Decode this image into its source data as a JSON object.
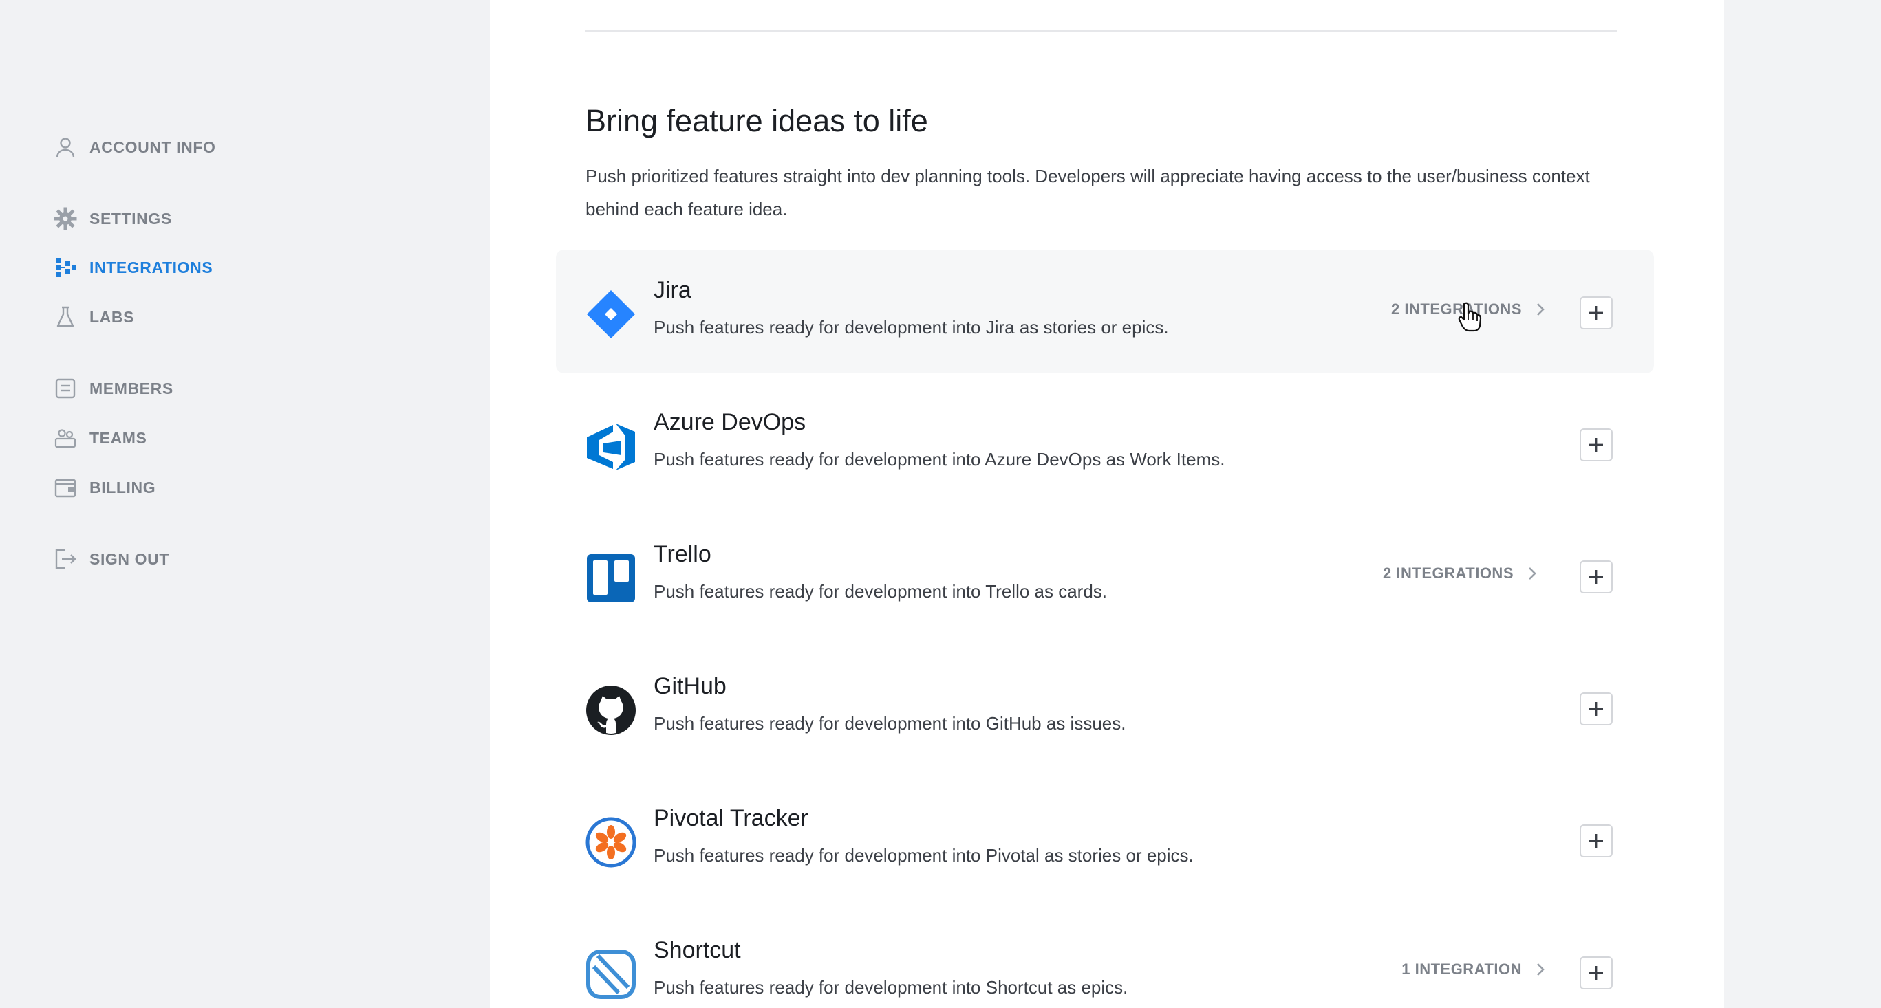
{
  "sidebar": {
    "items": [
      {
        "label": "ACCOUNT INFO",
        "icon": "user-icon",
        "active": false
      },
      {
        "label": "SETTINGS",
        "icon": "gear-icon",
        "active": false
      },
      {
        "label": "INTEGRATIONS",
        "icon": "integrations-icon",
        "active": true
      },
      {
        "label": "LABS",
        "icon": "flask-icon",
        "active": false
      },
      {
        "label": "MEMBERS",
        "icon": "members-icon",
        "active": false
      },
      {
        "label": "TEAMS",
        "icon": "teams-icon",
        "active": false
      },
      {
        "label": "BILLING",
        "icon": "wallet-icon",
        "active": false
      },
      {
        "label": "SIGN OUT",
        "icon": "sign-out-icon",
        "active": false
      }
    ]
  },
  "main": {
    "title": "Bring feature ideas to life",
    "description": "Push prioritized features straight into dev planning tools. Developers will appreciate having access to the user/business context behind each feature idea.",
    "integrations": [
      {
        "name": "Jira",
        "description": "Push features ready for development into Jira as stories or epics.",
        "count_label": "2 INTEGRATIONS",
        "icon": "jira-icon"
      },
      {
        "name": "Azure DevOps",
        "description": "Push features ready for development into Azure DevOps as Work Items.",
        "count_label": "",
        "icon": "azure-devops-icon"
      },
      {
        "name": "Trello",
        "description": "Push features ready for development into Trello as cards.",
        "count_label": "2 INTEGRATIONS",
        "icon": "trello-icon"
      },
      {
        "name": "GitHub",
        "description": "Push features ready for development into GitHub as issues.",
        "count_label": "",
        "icon": "github-icon"
      },
      {
        "name": "Pivotal Tracker",
        "description": "Push features ready for development into Pivotal as stories or epics.",
        "count_label": "",
        "icon": "pivotal-tracker-icon"
      },
      {
        "name": "Shortcut",
        "description": "Push features ready for development into Shortcut as epics.",
        "count_label": "1 INTEGRATION",
        "icon": "shortcut-icon"
      }
    ]
  },
  "colors": {
    "accent": "#1e7fdc",
    "muted": "#7c8189",
    "jira": "#2684ff",
    "azure": "#0078d4",
    "trello": "#0a66b7",
    "pivotal": "#f36f21",
    "shortcut": "#3e8fd6"
  }
}
